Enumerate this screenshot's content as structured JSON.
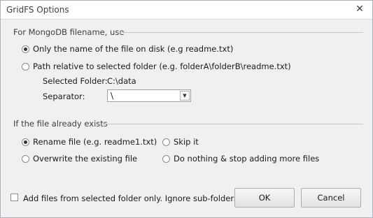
{
  "window": {
    "title": "GridFS Options",
    "close_icon": "close-icon"
  },
  "filename_section": {
    "title": "For MongoDB filename, use",
    "option_name_only": "Only the name of the file on disk (e.g readme.txt)",
    "option_relative_path": "Path relative to selected folder (e.g. folderA\\folderB\\readme.txt)",
    "selected_option": "name_only",
    "selected_folder_label": "Selected Folder:",
    "selected_folder_value": "C:\\data",
    "separator_label": "Separator:",
    "separator_value": "\\"
  },
  "exists_section": {
    "title": "If the file already exists",
    "options": {
      "rename": "Rename file (e.g. readme1.txt)",
      "skip": "Skip it",
      "overwrite": "Overwrite the existing file",
      "stop": "Do nothing & stop adding more files"
    },
    "selected_option": "rename"
  },
  "footer": {
    "checkbox_label": "Add files from selected folder only. Ignore sub-folders",
    "checkbox_checked": false,
    "ok_label": "OK",
    "cancel_label": "Cancel"
  }
}
